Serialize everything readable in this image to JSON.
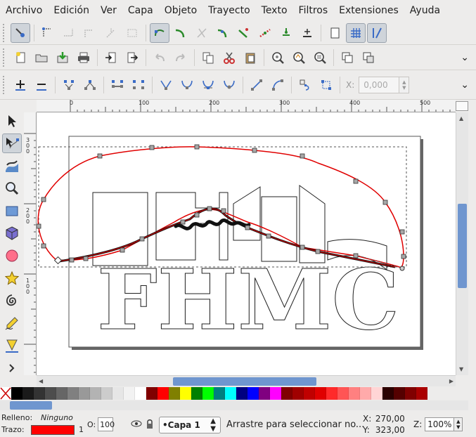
{
  "menu": [
    "Archivo",
    "Edición",
    "Ver",
    "Capa",
    "Objeto",
    "Trayecto",
    "Texto",
    "Filtros",
    "Extensiones",
    "Ayuda"
  ],
  "node_toolbar": {
    "x_label": "X:",
    "x_value": "0,000"
  },
  "ruler": {
    "h_labels": [
      "0",
      "100",
      "200",
      "300",
      "400",
      "500"
    ],
    "v_labels": [
      "3\n0\n0",
      "2\n0\n0",
      "1\n0\n0"
    ]
  },
  "canvas": {
    "logo_text": "FHMC",
    "colors": {
      "path_stroke": "#e00000",
      "selection_dash": "#555555",
      "node_fill": "#a8a8a8",
      "page_shadow": "#666666"
    }
  },
  "palette": [
    "#000000",
    "#1a1a1a",
    "#333333",
    "#4d4d4d",
    "#666666",
    "#808080",
    "#999999",
    "#b3b3b3",
    "#cccccc",
    "#e6e6e6",
    "#f2f2f2",
    "#ffffff",
    "#800000",
    "#ff0000",
    "#808000",
    "#ffff00",
    "#008000",
    "#00ff00",
    "#008080",
    "#00ffff",
    "#000080",
    "#0000ff",
    "#800080",
    "#ff00ff",
    "#800000",
    "#a00000",
    "#c00000",
    "#e00000",
    "#ff2a2a",
    "#ff5555",
    "#ff8080",
    "#ffaaaa",
    "#ffd5d5",
    "#2b0000",
    "#550000",
    "#800000",
    "#aa0000"
  ],
  "status": {
    "fill_label": "Relleno:",
    "fill_value": "Ninguno",
    "stroke_label": "Trazo:",
    "stroke_width": "1",
    "stroke_color": "#ff0000",
    "opacity_label": "O:",
    "opacity_value": "100",
    "layer": "•Capa 1",
    "message": "Arrastre para seleccionar no...",
    "x_label": "X:",
    "x_value": "270,00",
    "y_label": "Y:",
    "y_value": "323,00",
    "zoom_label": "Z:",
    "zoom_value": "100%"
  }
}
